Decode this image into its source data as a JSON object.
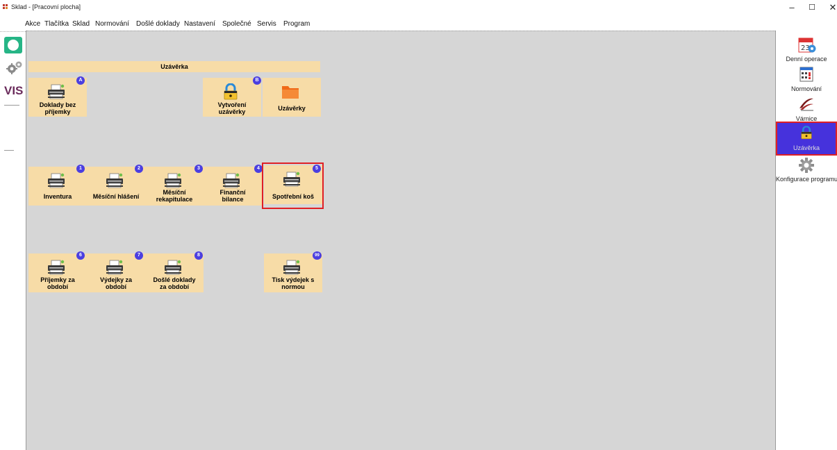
{
  "window": {
    "title": "Sklad - [Pracovní plocha]",
    "controls": {
      "minimize": "–",
      "maximize": "☐",
      "close": "✕",
      "restore": "_ 🗗"
    }
  },
  "menu": {
    "items": [
      "Akce",
      "Tlačítka",
      "Sklad",
      "Normování",
      "Došlé doklady",
      "Nastavení",
      "Společné",
      "Servis",
      "Program"
    ]
  },
  "left_toolbar": {
    "logo_text": "VIS"
  },
  "desktop": {
    "section_title": "Uzávěrka",
    "tiles": [
      {
        "label_line1": "Doklady bez",
        "label_line2": "příjemky",
        "badge": "A",
        "icon": "printer-icon"
      },
      {
        "label_line1": "Vytvoření",
        "label_line2": "uzávěrky",
        "badge": "B",
        "icon": "padlock-icon"
      },
      {
        "label_line1": "Uzávěrky",
        "label_line2": "",
        "badge": "",
        "icon": "folder-icon"
      },
      {
        "label_line1": "Inventura",
        "label_line2": "",
        "badge": "1",
        "icon": "printer-icon"
      },
      {
        "label_line1": "Měsíční hlášení",
        "label_line2": "",
        "badge": "2",
        "icon": "printer-icon"
      },
      {
        "label_line1": "Měsíční",
        "label_line2": "rekapitulace",
        "badge": "3",
        "icon": "printer-icon"
      },
      {
        "label_line1": "Finanční",
        "label_line2": "bilance",
        "badge": "4",
        "icon": "printer-icon"
      },
      {
        "label_line1": "Spotřební koš",
        "label_line2": "",
        "badge": "5",
        "icon": "printer-icon"
      },
      {
        "label_line1": "Příjemky za",
        "label_line2": "období",
        "badge": "6",
        "icon": "printer-icon"
      },
      {
        "label_line1": "Výdejky za",
        "label_line2": "období",
        "badge": "7",
        "icon": "printer-icon"
      },
      {
        "label_line1": "Došlé doklady",
        "label_line2": "za období",
        "badge": "8",
        "icon": "printer-icon"
      },
      {
        "label_line1": "Tisk výdejek s",
        "label_line2": "normou",
        "badge": "99",
        "icon": "printer-icon"
      }
    ]
  },
  "right_panel": {
    "items": [
      {
        "label": "Denní operace",
        "icon": "calendar-icon"
      },
      {
        "label": "Normování",
        "icon": "calculator-icon"
      },
      {
        "label": "Várnice",
        "icon": "varnice-logo-icon"
      },
      {
        "label": "Uzávěrka",
        "icon": "padlock-icon",
        "active": true
      },
      {
        "label": "Konfigurace programu",
        "icon": "gear-icon"
      }
    ],
    "calendar_day": "23"
  },
  "colors": {
    "tile_bg": "#f7dca7",
    "desktop_bg": "#d6d6d6",
    "badge_bg": "#4b3fe0",
    "active_bg": "#4632dc",
    "highlight_border": "#e01f24"
  }
}
